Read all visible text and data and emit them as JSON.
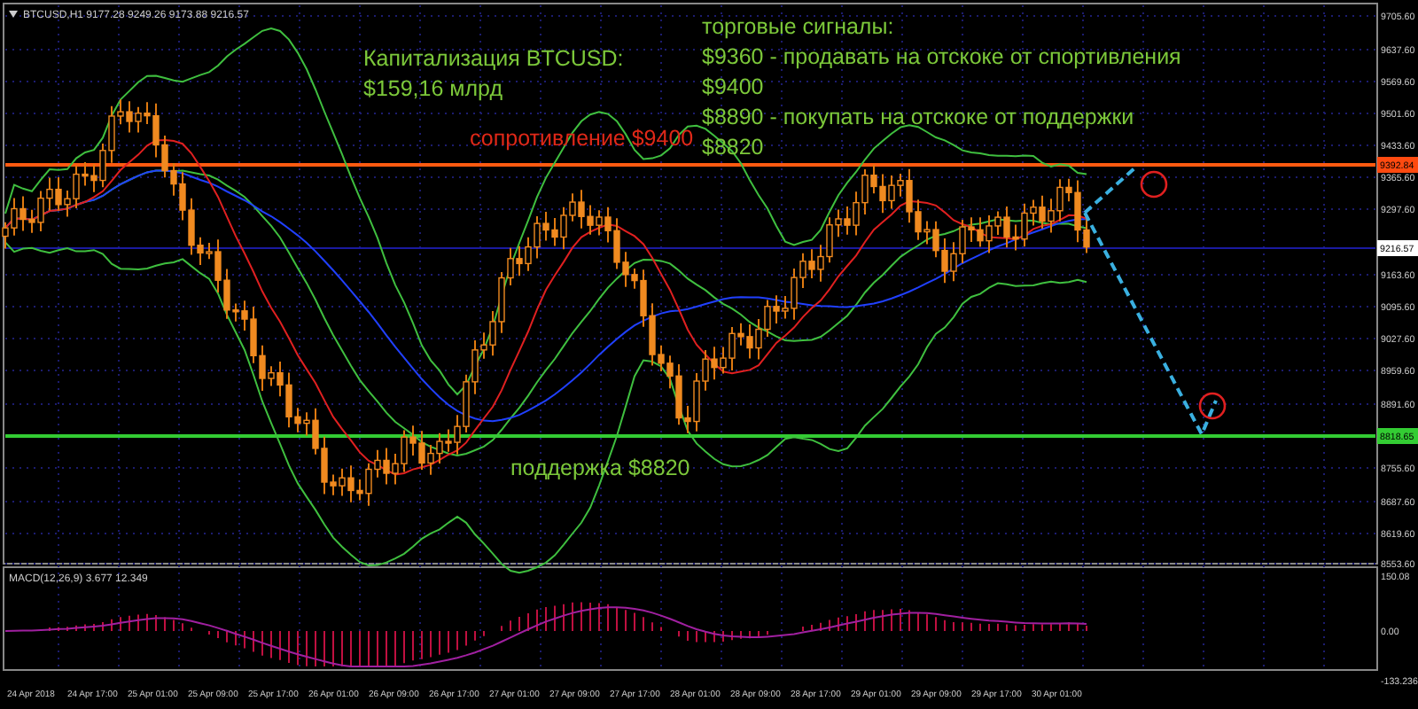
{
  "chart": {
    "header": {
      "symbol": "BTCUSD,H1",
      "values": "9177.28 9249.26 9173.88 9216.57"
    },
    "price_axis": [
      "9705.60",
      "9637.60",
      "9569.60",
      "9501.60",
      "9433.60",
      "9365.60",
      "9297.60",
      "9163.60",
      "9095.60",
      "9027.60",
      "8959.60",
      "8891.60",
      "8755.60",
      "8687.60",
      "8619.60",
      "8553.60"
    ],
    "markers": [
      {
        "label": "9392.84",
        "kind": "resistance"
      },
      {
        "label": "9216.57",
        "kind": "current"
      },
      {
        "label": "8818.65",
        "kind": "support"
      }
    ],
    "time_axis": [
      "24 Apr 2018",
      "24 Apr 17:00",
      "25 Apr 01:00",
      "25 Apr 09:00",
      "25 Apr 17:00",
      "26 Apr 01:00",
      "26 Apr 09:00",
      "26 Apr 17:00",
      "27 Apr 01:00",
      "27 Apr 09:00",
      "27 Apr 17:00",
      "28 Apr 01:00",
      "28 Apr 09:00",
      "28 Apr 17:00",
      "29 Apr 01:00",
      "29 Apr 09:00",
      "29 Apr 17:00",
      "30 Apr 01:00"
    ],
    "capitalization": [
      "Капитализация BTCUSD:",
      "$159,16 млрд"
    ],
    "signals": [
      "торговые сигналы:",
      "$9360 - продавать на отскоке от спортивления",
      "$9400",
      "$8890 - покупать на отскоке от поддержки",
      "$8820"
    ],
    "resistance_label": "сопротивление $9400",
    "support_label": "поддержка $8820",
    "macd": {
      "label": "MACD(12,26,9) 3.677 12.349",
      "axis": [
        "150.08",
        "0.00",
        "-133.236"
      ]
    }
  }
}
